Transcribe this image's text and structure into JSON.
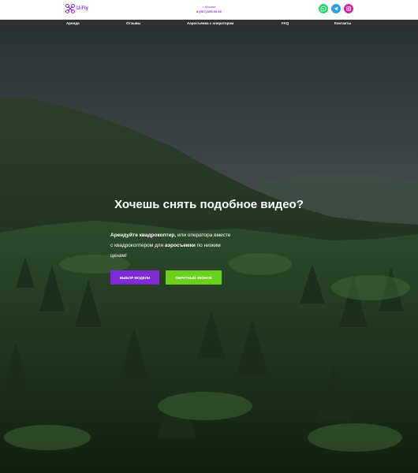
{
  "header": {
    "logo_text": "U-Fly",
    "city": "г. Москва",
    "phone": "8 (967) 655-66-66",
    "socials": [
      {
        "icon": "whatsapp-icon",
        "color": "#25d366"
      },
      {
        "icon": "telegram-icon",
        "color": "#2aa3dd"
      },
      {
        "icon": "instagram-icon",
        "color": "#d6249f"
      }
    ]
  },
  "nav": {
    "items": [
      "Аренда",
      "Отзывы",
      "Аэросъемка с оператором",
      "FAQ",
      "Контакты"
    ]
  },
  "hero": {
    "title": "Хочешь снять подобное видео?",
    "text_part1": "Арендуйте квадрокоптер,",
    "text_part2": " или оператора вместе с квадрокоптером для ",
    "text_part3": "аэросъемки",
    "text_part4": " по низким ценам!",
    "btn_model": "ВЫБОР МОДЕЛИ",
    "btn_call": "ОБРАТНЫЙ ЗВОНОК"
  }
}
